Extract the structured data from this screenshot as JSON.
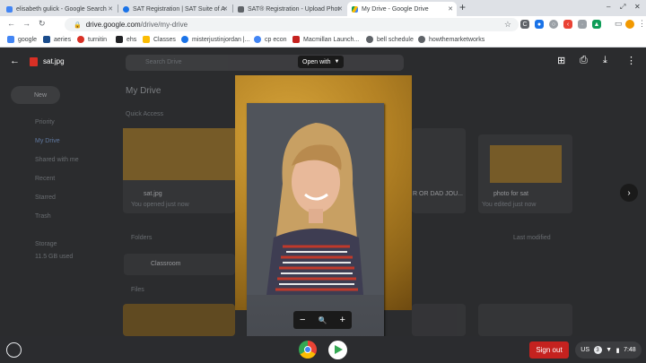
{
  "tabs": [
    {
      "label": "elisabeth gulick - Google Search",
      "color": "#4285f4"
    },
    {
      "label": "SAT Registration | SAT Suite of A",
      "color": "#1a73e8"
    },
    {
      "label": "SAT® Registration - Upload Phot",
      "color": "#5f6368"
    },
    {
      "label": "My Drive - Google Drive",
      "color": "#fbbc04"
    }
  ],
  "window": {
    "minimize": "–",
    "restore": "⤢",
    "close": "✕",
    "new_tab": "+"
  },
  "omnibox": {
    "host": "drive.google.com",
    "path": "/drive/my-drive"
  },
  "bookmarks": [
    {
      "label": "google",
      "color": "#4285f4"
    },
    {
      "label": "aeries",
      "color": "#1a4c8c"
    },
    {
      "label": "turnitin",
      "color": "#d93025"
    },
    {
      "label": "ehs",
      "color": "#202124"
    },
    {
      "label": "Classes",
      "color": "#fbbc04"
    },
    {
      "label": "misterjustinjordan |...",
      "color": "#1a73e8"
    },
    {
      "label": "cp econ",
      "color": "#4285f4"
    },
    {
      "label": "Macmillan Launch...",
      "color": "#c5221f"
    },
    {
      "label": "bell schedule",
      "color": "#5f6368"
    },
    {
      "label": "howthemarketworks",
      "color": "#5f6368"
    }
  ],
  "viewer": {
    "filename": "sat.jpg",
    "open_with": "Open with",
    "zoom_out": "−",
    "zoom_icon": "🔍",
    "zoom_in": "+",
    "next": "›"
  },
  "drive_bg": {
    "search": "Search Drive",
    "new": "New",
    "my_drive": "My Drive",
    "quick_access": "Quick Access",
    "nav": [
      "Priority",
      "My Drive",
      "Shared with me",
      "Recent",
      "Starred",
      "Trash"
    ],
    "storage": "Storage",
    "storage_used": "11.5 GB used",
    "folders": "Folders",
    "folder_name": "Classroom",
    "files": "Files",
    "last_modified": "Last modified",
    "card1_name": "sat.jpg",
    "card1_sub": "You opened just now",
    "card2_name": "R OR DAD JOU...",
    "card3_name": "photo for sat",
    "card3_sub": "You edited just now"
  },
  "shelf": {
    "sign_out": "Sign out",
    "locale": "US",
    "notif_count": "3",
    "time": "7:48"
  }
}
